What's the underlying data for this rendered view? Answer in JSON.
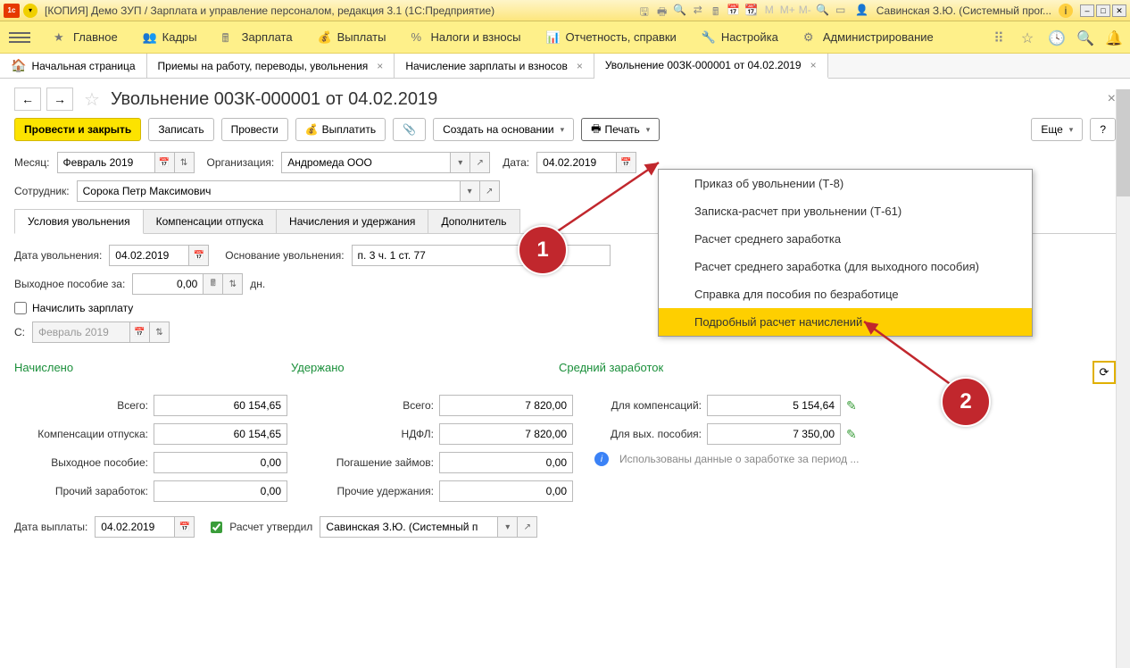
{
  "titlebar": {
    "title": "[КОПИЯ] Демо ЗУП / Зарплата и управление персоналом, редакция 3.1  (1С:Предприятие)",
    "user": "Савинская З.Ю. (Системный прог..."
  },
  "mainmenu": {
    "items": [
      {
        "label": "Главное"
      },
      {
        "label": "Кадры"
      },
      {
        "label": "Зарплата"
      },
      {
        "label": "Выплаты"
      },
      {
        "label": "Налоги и взносы"
      },
      {
        "label": "Отчетность, справки"
      },
      {
        "label": "Настройка"
      },
      {
        "label": "Администрирование"
      }
    ]
  },
  "tabs": {
    "home": "Начальная страница",
    "items": [
      {
        "label": "Приемы на работу, переводы, увольнения"
      },
      {
        "label": "Начисление зарплаты и взносов"
      },
      {
        "label": "Увольнение 00ЗК-000001 от 04.02.2019",
        "active": true
      }
    ]
  },
  "doc": {
    "title": "Увольнение 00ЗК-000001 от 04.02.2019",
    "toolbar": {
      "post_close": "Провести и закрыть",
      "save": "Записать",
      "post": "Провести",
      "pay": "Выплатить",
      "create_based": "Создать на основании",
      "print": "Печать",
      "more": "Еще"
    },
    "fields": {
      "month_label": "Месяц:",
      "month_value": "Февраль 2019",
      "org_label": "Организация:",
      "org_value": "Андромеда ООО",
      "date_label": "Дата:",
      "date_value": "04.02.2019",
      "employee_label": "Сотрудник:",
      "employee_value": "Сорока Петр Максимович"
    },
    "inner_tabs": [
      {
        "label": "Условия увольнения",
        "active": true
      },
      {
        "label": "Компенсации отпуска"
      },
      {
        "label": "Начисления и удержания"
      },
      {
        "label": "Дополнитель"
      }
    ],
    "dismissal": {
      "date_label": "Дата увольнения:",
      "date_value": "04.02.2019",
      "basis_label": "Основание увольнения:",
      "basis_value": "п. 3 ч. 1 ст. 77",
      "severance_label": "Выходное пособие за:",
      "severance_value": "0,00",
      "severance_unit": "дн.",
      "calc_salary_label": "Начислить зарплату",
      "from_label": "С:",
      "from_value": "Февраль 2019"
    },
    "sections": {
      "accrued": "Начислено",
      "withheld": "Удержано",
      "avg_earning": "Средний заработок"
    },
    "accrued": {
      "total_label": "Всего:",
      "total_value": "60 154,65",
      "vacation_comp_label": "Компенсации отпуска:",
      "vacation_comp_value": "60 154,65",
      "severance_label": "Выходное пособие:",
      "severance_value": "0,00",
      "other_label": "Прочий заработок:",
      "other_value": "0,00"
    },
    "withheld": {
      "total_label": "Всего:",
      "total_value": "7 820,00",
      "ndfl_label": "НДФЛ:",
      "ndfl_value": "7 820,00",
      "loans_label": "Погашение займов:",
      "loans_value": "0,00",
      "other_label": "Прочие удержания:",
      "other_value": "0,00"
    },
    "avg": {
      "comp_label": "Для компенсаций:",
      "comp_value": "5 154,64",
      "sev_label": "Для вых. пособия:",
      "sev_value": "7 350,00",
      "info_text": "Использованы данные о заработке за период ..."
    },
    "footer": {
      "payout_date_label": "Дата выплаты:",
      "payout_date_value": "04.02.2019",
      "approved_label": "Расчет утвердил",
      "approver_value": "Савинская З.Ю. (Системный п"
    }
  },
  "print_menu": {
    "items": [
      "Приказ об увольнении (Т-8)",
      "Записка-расчет при увольнении (Т-61)",
      "Расчет среднего заработка",
      "Расчет среднего заработка (для выходного пособия)",
      "Справка для пособия по безработице",
      "Подробный расчет начислений"
    ]
  },
  "callouts": {
    "c1": "1",
    "c2": "2"
  }
}
